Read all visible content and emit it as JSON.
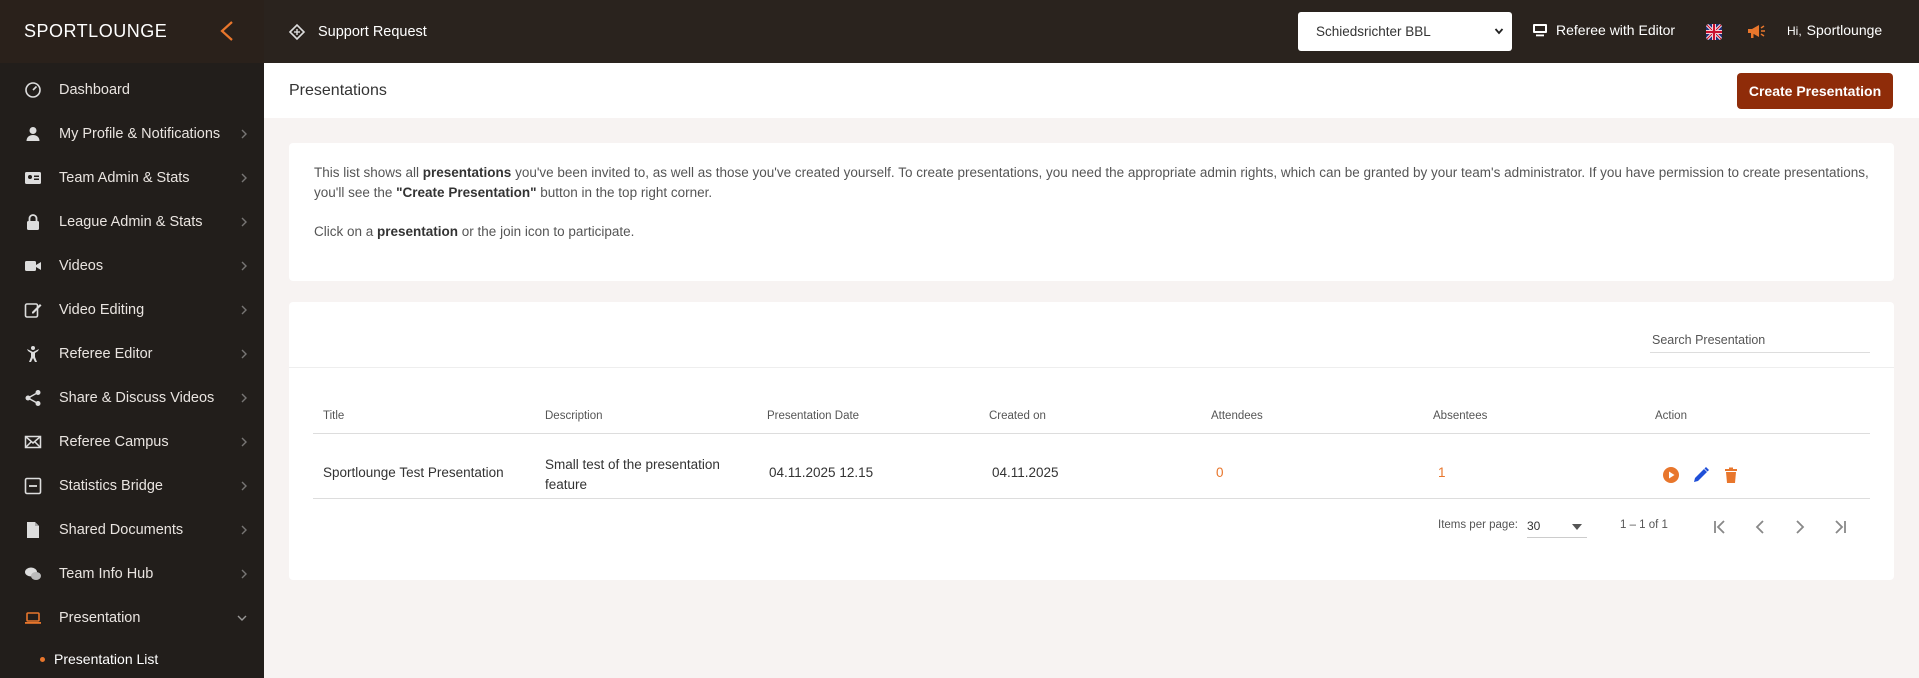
{
  "app": {
    "brand": "SPORTLOUNGE"
  },
  "sidebar": {
    "items": [
      {
        "label": "Dashboard",
        "icon": "dashboard-icon",
        "chevron": false
      },
      {
        "label": "My Profile & Notifications",
        "icon": "person-icon",
        "chevron": true
      },
      {
        "label": "Team Admin & Stats",
        "icon": "id-card-icon",
        "chevron": true
      },
      {
        "label": "League Admin & Stats",
        "icon": "lock-icon",
        "chevron": true
      },
      {
        "label": "Videos",
        "icon": "video-camera-icon",
        "chevron": true
      },
      {
        "label": "Video Editing",
        "icon": "edit-icon",
        "chevron": true
      },
      {
        "label": "Referee Editor",
        "icon": "referee-icon",
        "chevron": true
      },
      {
        "label": "Share & Discuss Videos",
        "icon": "share-icon",
        "chevron": true
      },
      {
        "label": "Referee Campus",
        "icon": "campus-icon",
        "chevron": true
      },
      {
        "label": "Statistics Bridge",
        "icon": "bridge-icon",
        "chevron": true
      },
      {
        "label": "Shared Documents",
        "icon": "document-icon",
        "chevron": true
      },
      {
        "label": "Team Info Hub",
        "icon": "chat-icon",
        "chevron": true
      },
      {
        "label": "Presentation",
        "icon": "laptop-icon",
        "chevron": "down"
      }
    ],
    "sub_items": [
      {
        "label": "Presentation List"
      }
    ]
  },
  "topbar": {
    "support_label": "Support Request",
    "team_select_value": "Schiedsrichter BBL",
    "mode_label": "Referee with Editor",
    "greeting_prefix": "Hi,",
    "user_name": "Sportlounge"
  },
  "page": {
    "title": "Presentations",
    "create_button": "Create Presentation"
  },
  "info": {
    "p1_a": "This list shows all ",
    "p1_b": "presentations",
    "p1_c": " you've been invited to, as well as those you've created yourself. To create presentations, you need the appropriate admin rights, which can be granted by your team's administrator. If you have permission to create presentations, you'll see the ",
    "p1_d": "\"Create Presentation\"",
    "p1_e": " button in the top right corner.",
    "p2_a": "Click on a ",
    "p2_b": "presentation",
    "p2_c": " or the join icon to participate."
  },
  "table": {
    "search_placeholder": "Search Presentation",
    "headers": [
      "Title",
      "Description",
      "Presentation Date",
      "Created on",
      "Attendees",
      "Absentees",
      "Action"
    ],
    "rows": [
      {
        "title": "Sportlounge Test Presentation",
        "description_line1": "Small test of the presentation",
        "description_line2": "feature",
        "presentation_date": "04.11.2025 12.15",
        "created_on": "04.11.2025",
        "attendees": "0",
        "absentees": "1"
      }
    ],
    "pagination": {
      "items_per_page_label": "Items per page:",
      "items_per_page": "30",
      "range": "1 – 1 of 1"
    }
  },
  "colors": {
    "sidebar_bg": "#221e1b",
    "topbar_bg": "#2a231e",
    "accent": "#e8762c",
    "primary_button": "#8f2c09",
    "edit_icon": "#1f4fd8",
    "delete_icon": "#e8762c"
  }
}
